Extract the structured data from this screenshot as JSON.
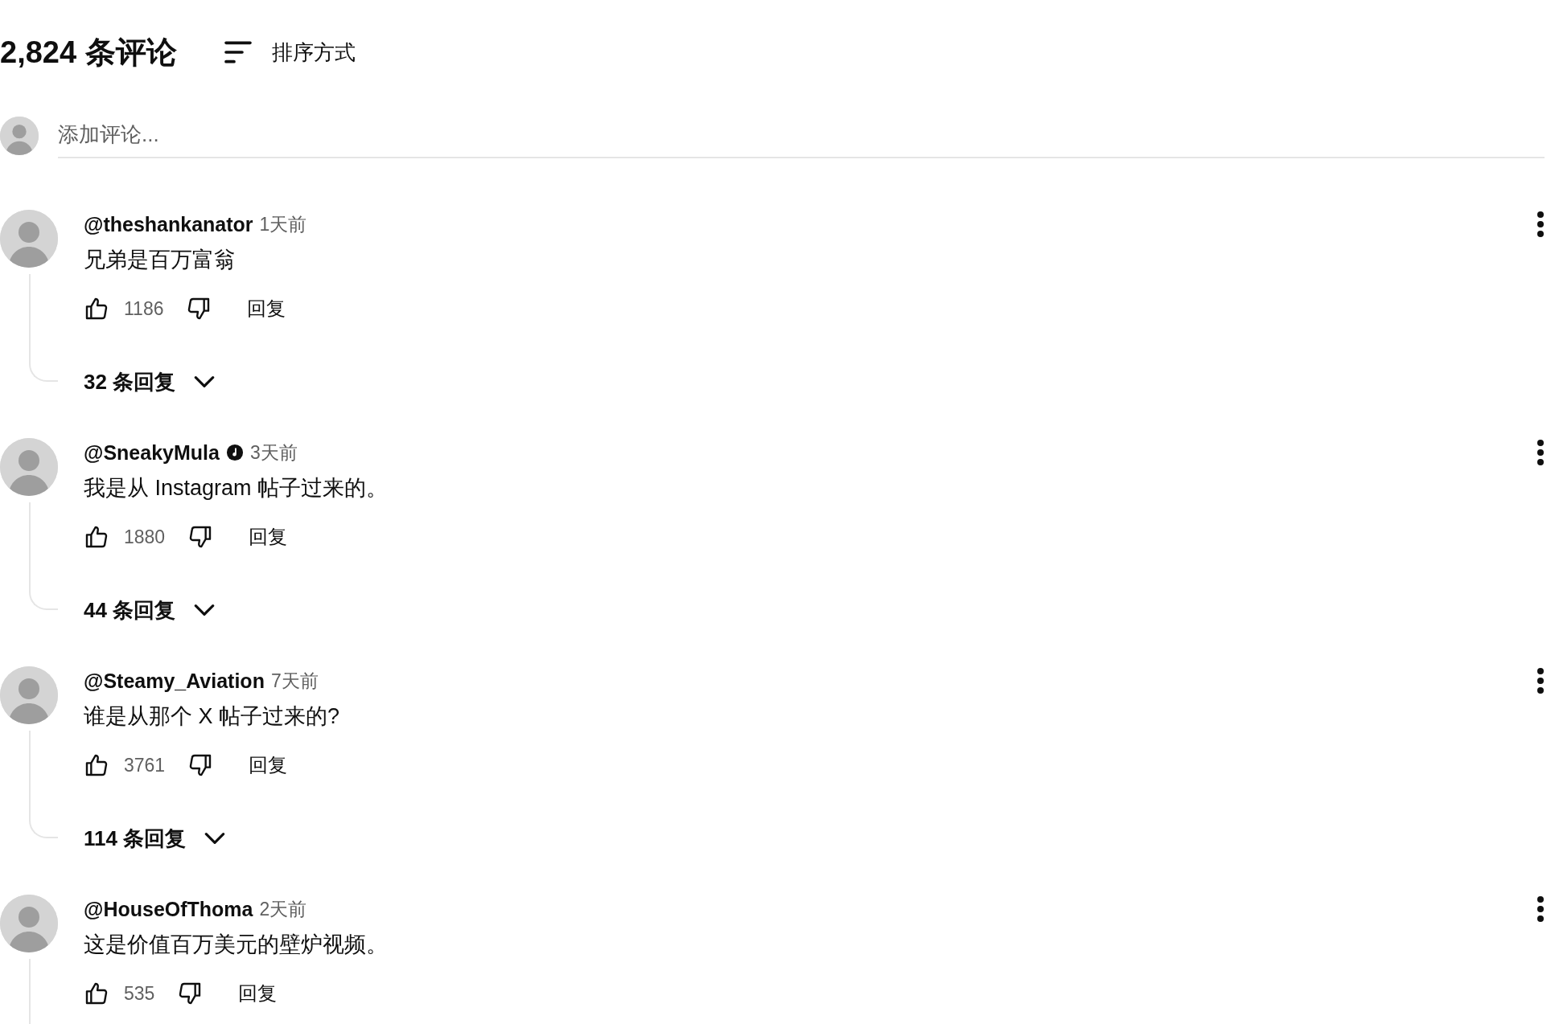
{
  "header": {
    "count_title": "2,824 条评论",
    "sort_label": "排序方式"
  },
  "add_comment": {
    "placeholder": "添加评论..."
  },
  "comments": [
    {
      "author": "@theshankanator",
      "verified": false,
      "time": "1天前",
      "text": "兄弟是百万富翁",
      "likes": "1186",
      "reply_label": "回复",
      "replies_label": "32 条回复"
    },
    {
      "author": "@SneakyMula",
      "verified": true,
      "time": "3天前",
      "text": "我是从 Instagram 帖子过来的。",
      "likes": "1880",
      "reply_label": "回复",
      "replies_label": "44 条回复"
    },
    {
      "author": "@Steamy_Aviation",
      "verified": false,
      "time": "7天前",
      "text": "谁是从那个 X 帖子过来的?",
      "likes": "3761",
      "reply_label": "回复",
      "replies_label": "114 条回复"
    },
    {
      "author": "@HouseOfThoma",
      "verified": false,
      "time": "2天前",
      "text": "这是价值百万美元的壁炉视频。",
      "likes": "535",
      "reply_label": "回复"
    }
  ]
}
